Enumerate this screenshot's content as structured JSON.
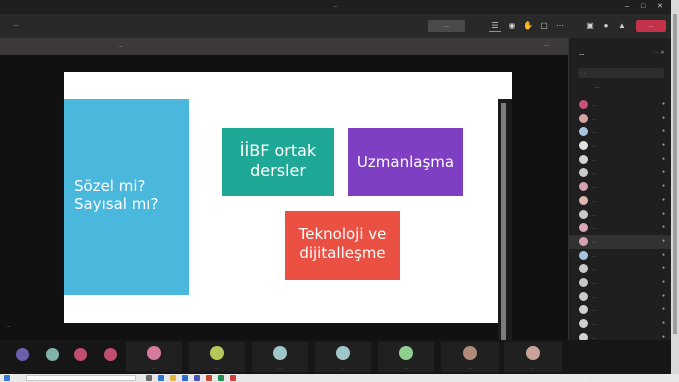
{
  "window": {
    "title": "…",
    "minimize": "–",
    "maximize": "□",
    "close": "✕"
  },
  "toolbar": {
    "timer": "…",
    "stop_share_label": "…",
    "leave_label": "…",
    "leave_color": "#c4314b"
  },
  "banner": {
    "text": "…",
    "close_label": "…"
  },
  "slide": {
    "box_sozel": [
      "Sözel mi?",
      "Sayısal mı?"
    ],
    "box_iibf": [
      "İİBF ortak",
      "dersler"
    ],
    "box_uzman": "Uzmanlaşma",
    "box_tekno": [
      "Teknoloji ve",
      "dijitalleşme"
    ],
    "colors": {
      "sozel": "#4ab7dd",
      "iibf": "#1fa896",
      "uzman": "#7e3fc2",
      "tekno": "#ea5143"
    }
  },
  "presenter_label": "…",
  "participants": {
    "title": "…",
    "search_placeholder": "…",
    "section_label": "…",
    "list": [
      {
        "name": "…",
        "avatar_color": "#c7517a"
      },
      {
        "name": "…",
        "avatar_color": "#d9a3a8"
      },
      {
        "name": "…",
        "avatar_color": "#a7c4e0"
      },
      {
        "name": "…",
        "avatar_color": "#e2e2e2"
      },
      {
        "name": "…",
        "avatar_color": "#d5d5d5"
      },
      {
        "name": "…",
        "avatar_color": "#c9c9c9"
      },
      {
        "name": "…",
        "avatar_color": "#d4a1b4"
      },
      {
        "name": "…",
        "avatar_color": "#e0b3b3"
      },
      {
        "name": "…",
        "avatar_color": "#c9c9c9"
      },
      {
        "name": "…",
        "avatar_color": "#d9a8b8"
      },
      {
        "name": "…",
        "avatar_color": "#d6a0b0",
        "highlighted": true
      },
      {
        "name": "…",
        "avatar_color": "#a8c3df"
      },
      {
        "name": "…",
        "avatar_color": "#c9c9c9"
      },
      {
        "name": "…",
        "avatar_color": "#c7c7c7"
      },
      {
        "name": "…",
        "avatar_color": "#c9c9c9"
      },
      {
        "name": "…",
        "avatar_color": "#d0d0d0"
      },
      {
        "name": "…",
        "avatar_color": "#cfcfcf"
      },
      {
        "name": "…",
        "avatar_color": "#d2d2d2"
      }
    ]
  },
  "tiles": [
    {
      "name": "…",
      "avatar_color": "#d47a9a"
    },
    {
      "name": "…",
      "avatar_color": "#b7c85a"
    },
    {
      "name": "…",
      "avatar_color": "#9fc6c8"
    },
    {
      "name": "…",
      "avatar_color": "#9fc6c8"
    },
    {
      "name": "…",
      "avatar_color": "#8fcf8f"
    },
    {
      "name": "…",
      "avatar_color": "#b08a7a"
    },
    {
      "name": "…",
      "avatar_color": "#c9a29a"
    }
  ],
  "small_avatars": [
    {
      "color": "#6c5fae"
    },
    {
      "color": "#7fb3a8"
    },
    {
      "color": "#c04f6f"
    },
    {
      "color": "#c04f6f"
    }
  ],
  "taskbar": {
    "search_placeholder": "…",
    "tray_text": "…"
  }
}
